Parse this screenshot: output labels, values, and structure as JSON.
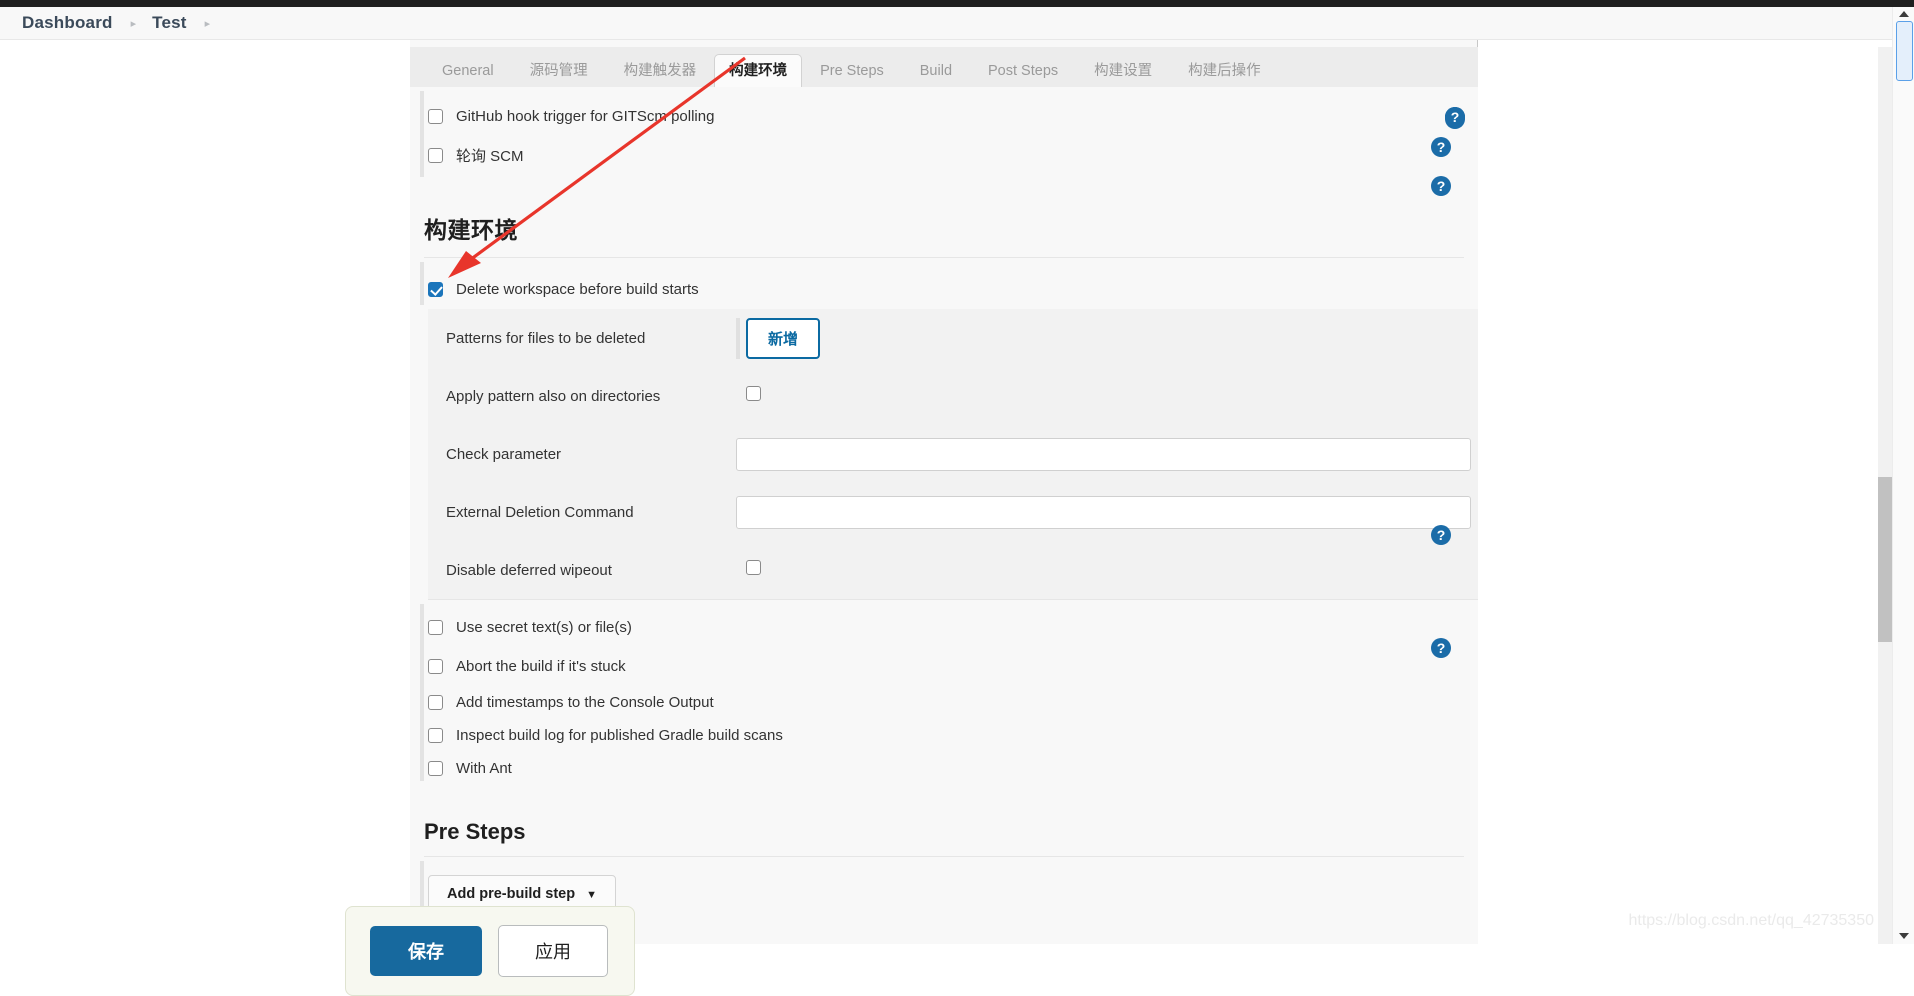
{
  "breadcrumb": {
    "items": [
      "Dashboard",
      "Test"
    ],
    "separator": "▸"
  },
  "tabs": [
    {
      "label": "General",
      "active": false
    },
    {
      "label": "源码管理",
      "active": false
    },
    {
      "label": "构建触发器",
      "active": false
    },
    {
      "label": "构建环境",
      "active": true
    },
    {
      "label": "Pre Steps",
      "active": false
    },
    {
      "label": "Build",
      "active": false
    },
    {
      "label": "Post Steps",
      "active": false
    },
    {
      "label": "构建设置",
      "active": false
    },
    {
      "label": "构建后操作",
      "active": false
    }
  ],
  "trigger_options": [
    {
      "label": "GitHub hook trigger for GITScm polling",
      "checked": false
    },
    {
      "label": "轮询 SCM",
      "checked": false
    }
  ],
  "build_env": {
    "heading": "构建环境",
    "delete_workspace": {
      "label": "Delete workspace before build starts",
      "checked": true
    },
    "options": {
      "patterns": {
        "label": "Patterns for files to be deleted",
        "add_button": "新增"
      },
      "apply_directories": {
        "label": "Apply pattern also on directories",
        "checked": false
      },
      "check_parameter": {
        "label": "Check parameter",
        "value": "",
        "placeholder": ""
      },
      "external_deletion": {
        "label": "External Deletion Command",
        "value": "",
        "placeholder": ""
      },
      "disable_deferred": {
        "label": "Disable deferred wipeout",
        "checked": false
      }
    },
    "extra_options": [
      {
        "label": "Use secret text(s) or file(s)",
        "checked": false,
        "help": true
      },
      {
        "label": "Abort the build if it's stuck",
        "checked": false,
        "help": false
      },
      {
        "label": "Add timestamps to the Console Output",
        "checked": false,
        "help": false
      },
      {
        "label": "Inspect build log for published Gradle build scans",
        "checked": false,
        "help": false
      },
      {
        "label": "With Ant",
        "checked": false,
        "help": true
      }
    ]
  },
  "pre_steps": {
    "heading": "Pre Steps",
    "add_step_button": "Add pre-build step",
    "caret": "▼"
  },
  "save_bar": {
    "save_label": "保存",
    "apply_label": "应用"
  },
  "background_text": {
    "build_ghost": "Build"
  },
  "help_icon": {
    "glyph": "?"
  },
  "watermark": {
    "text": "https://blog.csdn.net/qq_42735350"
  },
  "colors": {
    "accent_blue": "#1b6ca8",
    "save_blue": "#17699e",
    "add_button_border": "#0b6aa2",
    "checkbox_checked": "#1b75bb",
    "annotation_red": "#e8352b",
    "panel_bg": "#f8f8f8",
    "tabbar_bg": "#ececec"
  }
}
